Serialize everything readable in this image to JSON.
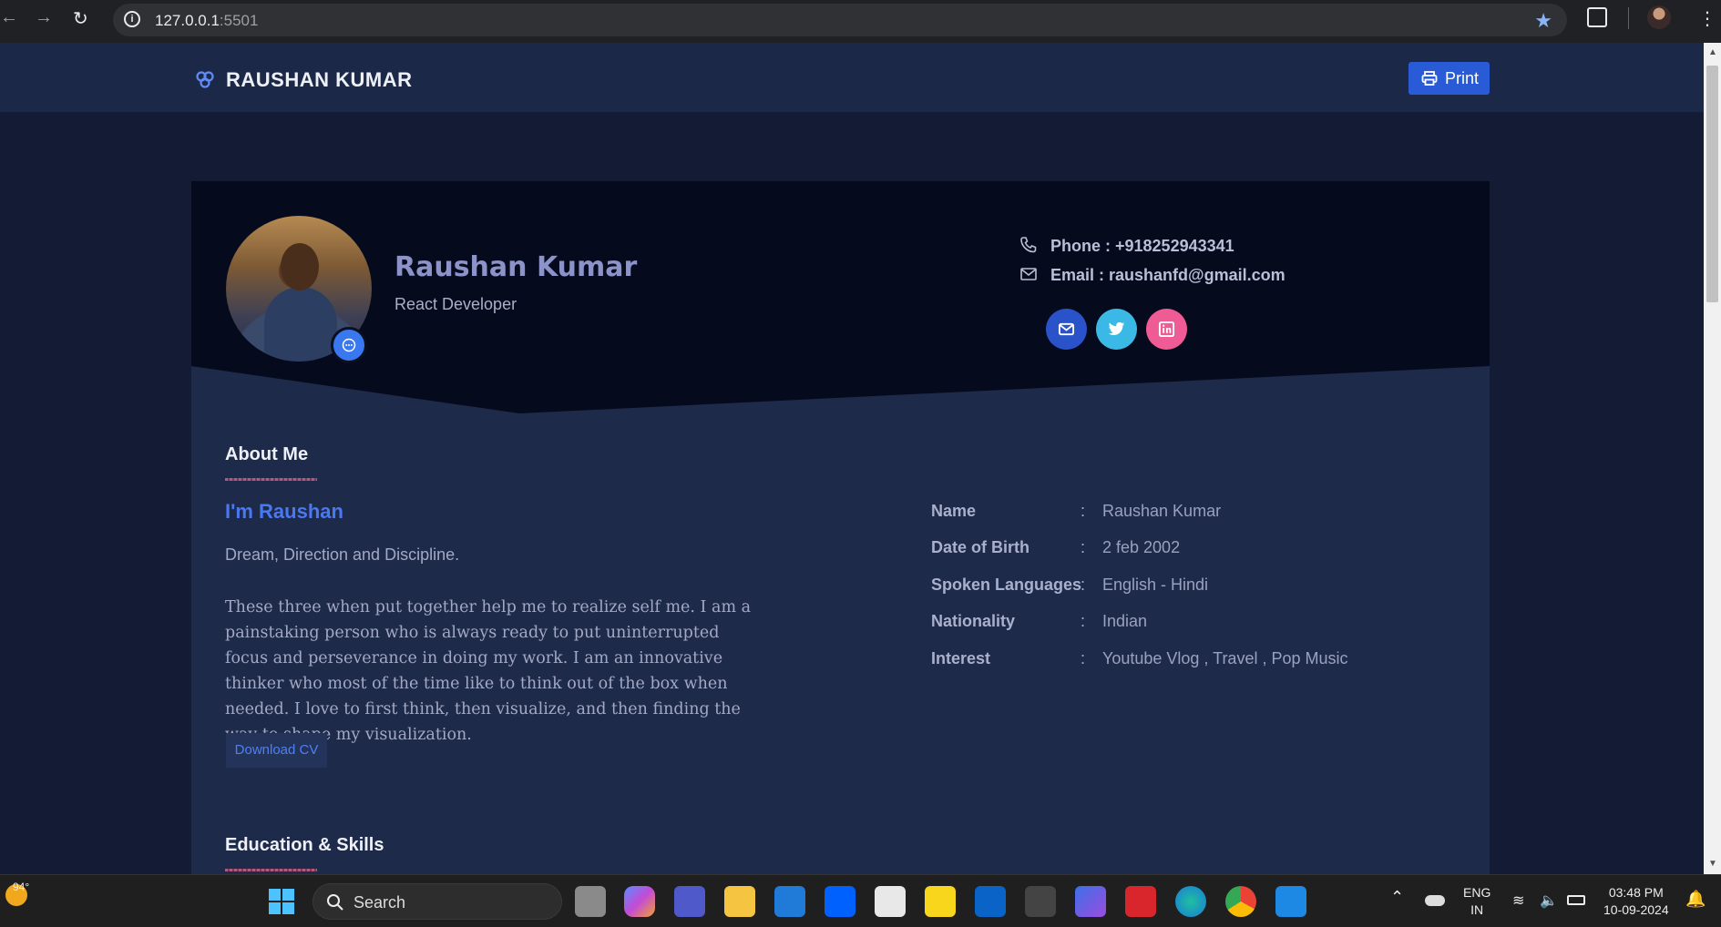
{
  "browser": {
    "url_host": "127.0.0.1",
    "url_port": ":5501"
  },
  "header": {
    "brand": "RAUSHAN KUMAR",
    "print_label": "Print"
  },
  "profile": {
    "name": "Raushan Kumar",
    "role": "React Developer",
    "phone": "Phone : +918252943341",
    "email": "Email : raushanfd@gmail.com"
  },
  "social": [
    {
      "name": "email",
      "color": "#2a52c9"
    },
    {
      "name": "twitter",
      "color": "#3bb9e6"
    },
    {
      "name": "linkedin",
      "color": "#ef5b95"
    }
  ],
  "about": {
    "title": "About Me",
    "intro": "I'm Raushan",
    "tagline": "Dream, Direction and Discipline.",
    "paragraph": "These three when put together help me to realize self me. I am a painstaking person who is always ready to put uninterrupted focus and perseverance in doing my work. I am an innovative thinker who most of the time like to think out of the box when needed. I love to first think, then visualize, and then finding the way to shape my visualization.",
    "download_label": "Download CV",
    "details": [
      {
        "key": "Name",
        "sep": ":",
        "value": "Raushan Kumar"
      },
      {
        "key": "Date of Birth",
        "sep": ":",
        "value": "2 feb 2002"
      },
      {
        "key": "Spoken Languages",
        "sep": ":",
        "value": "English - Hindi"
      },
      {
        "key": "Nationality",
        "sep": ":",
        "value": "Indian"
      },
      {
        "key": "Interest",
        "sep": ":",
        "value": "Youtube Vlog , Travel , Pop Music"
      }
    ]
  },
  "education": {
    "title": "Education & Skills"
  },
  "taskbar": {
    "weather": "94°",
    "search_label": "Search",
    "lang_top": "ENG",
    "lang_bottom": "IN",
    "time": "03:48 PM",
    "date": "10-09-2024"
  }
}
